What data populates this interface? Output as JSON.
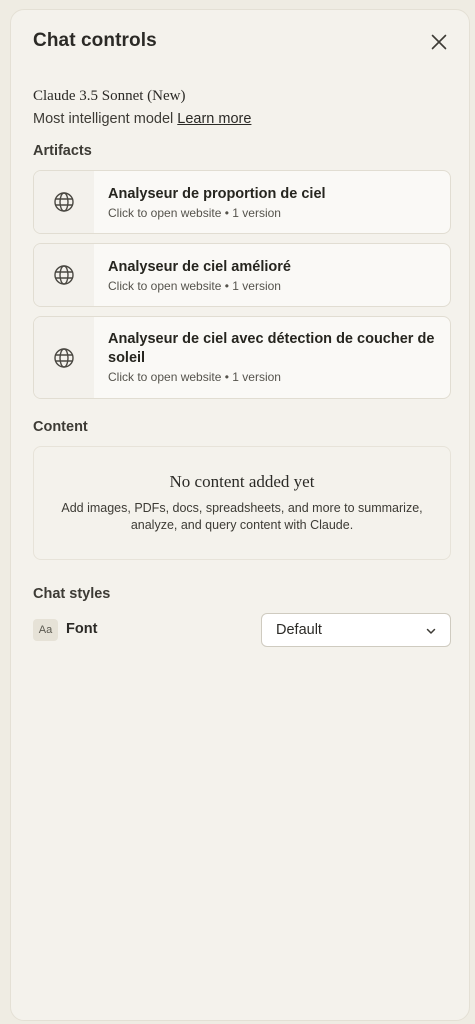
{
  "header": {
    "title": "Chat controls",
    "close_icon": "close-icon"
  },
  "model": {
    "name": "Claude 3.5 Sonnet (New)",
    "description": "Most intelligent model",
    "learn_more": "Learn more"
  },
  "artifacts": {
    "section_title": "Artifacts",
    "items": [
      {
        "icon": "globe-icon",
        "title": "Analyseur de proportion de ciel",
        "subtitle": "Click to open website • 1 version"
      },
      {
        "icon": "globe-icon",
        "title": "Analyseur de ciel amélioré",
        "subtitle": "Click to open website • 1 version"
      },
      {
        "icon": "globe-icon",
        "title": "Analyseur de ciel avec détection de coucher de soleil",
        "subtitle": "Click to open website • 1 version"
      }
    ]
  },
  "content": {
    "section_title": "Content",
    "empty_title": "No content added yet",
    "empty_desc": "Add images, PDFs, docs, spreadsheets, and more to summarize, analyze, and query content with Claude."
  },
  "chat_styles": {
    "section_title": "Chat styles",
    "font_icon_text": "Aa",
    "font_label": "Font",
    "font_value": "Default",
    "dropdown_icon": "chevron-down-icon"
  }
}
